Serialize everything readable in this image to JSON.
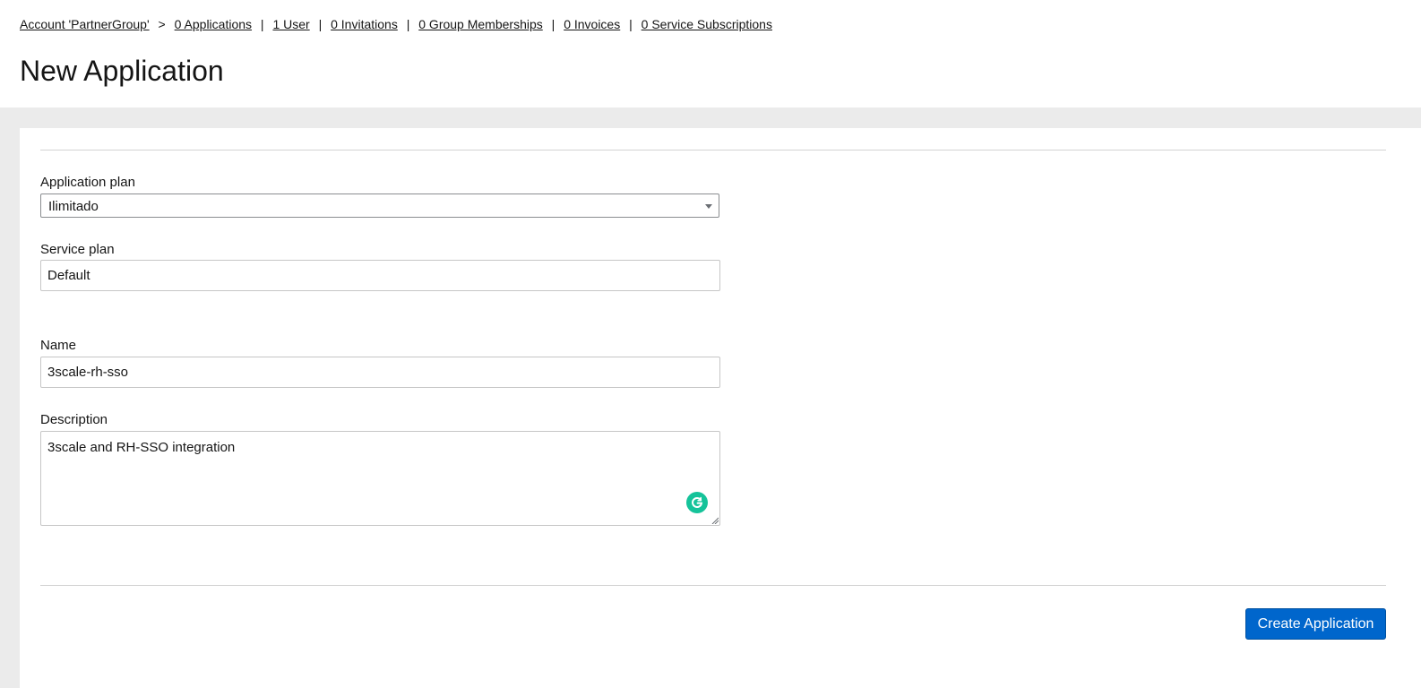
{
  "breadcrumb": {
    "account": "Account 'PartnerGroup'",
    "chevron": ">",
    "divider": "|",
    "links": [
      "0 Applications",
      "1 User",
      "0 Invitations",
      "0 Group Memberships",
      "0 Invoices",
      "0 Service Subscriptions"
    ]
  },
  "page": {
    "title": "New Application"
  },
  "form": {
    "application_plan": {
      "label": "Application plan",
      "value": "Ilimitado"
    },
    "service_plan": {
      "label": "Service plan",
      "value": "Default"
    },
    "name": {
      "label": "Name",
      "value": "3scale-rh-sso"
    },
    "description": {
      "label": "Description",
      "value": "3scale and RH-SSO integration"
    },
    "submit_label": "Create Application"
  },
  "colors": {
    "primary": "#0066cc",
    "grammarly": "#15c39a",
    "page_bg": "#ebebeb"
  },
  "icons": {
    "grammarly": "grammarly-icon",
    "resize": "resize-handle-icon",
    "select_caret": "caret-down-icon"
  }
}
